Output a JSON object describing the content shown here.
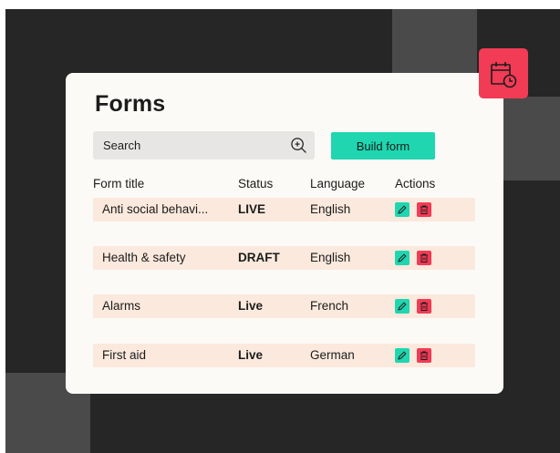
{
  "card": {
    "title": "Forms"
  },
  "search": {
    "placeholder": "Search",
    "icon": "zoom-in-icon"
  },
  "build_button": {
    "label": "Build form"
  },
  "table": {
    "headers": [
      "Form title",
      "Status",
      "Language",
      "Actions"
    ],
    "rows": [
      {
        "title": "Anti social behavi...",
        "status": "LIVE",
        "language": "English"
      },
      {
        "title": "Health & safety",
        "status": "DRAFT",
        "language": "English"
      },
      {
        "title": "Alarms",
        "status": "Live",
        "language": "French"
      },
      {
        "title": "First aid",
        "status": "Live",
        "language": "German"
      }
    ],
    "actions": [
      "edit-icon",
      "delete-icon"
    ]
  },
  "badge": {
    "icon": "calendar-clock-icon"
  },
  "colors": {
    "accent_teal": "#1fd6b0",
    "accent_red": "#f23b55",
    "draft_orange": "#ee8b3b",
    "row_background": "#fbe9dd",
    "background_dark": "#262626"
  }
}
